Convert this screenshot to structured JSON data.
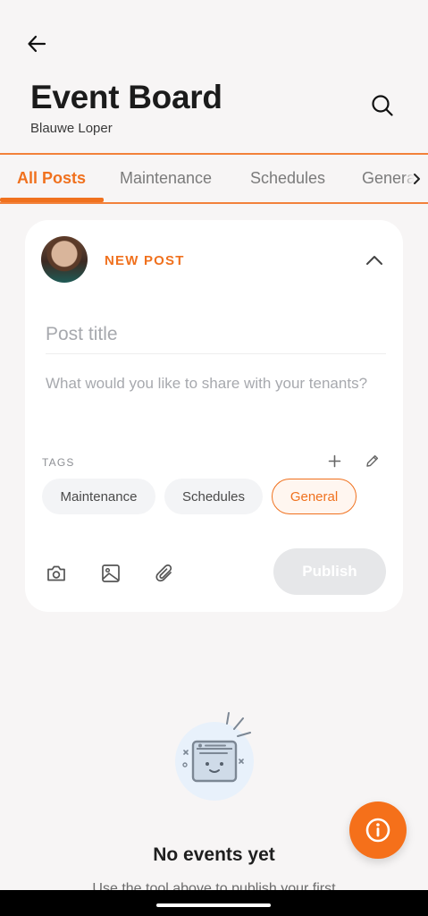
{
  "header": {
    "title": "Event Board",
    "subtitle": "Blauwe Loper",
    "back_icon": "arrow-left-icon",
    "search_icon": "search-icon"
  },
  "tabs": [
    {
      "label": "All Posts",
      "active": true
    },
    {
      "label": "Maintenance",
      "active": false
    },
    {
      "label": "Schedules",
      "active": false
    },
    {
      "label": "General",
      "active": false
    }
  ],
  "composer": {
    "label": "NEW POST",
    "title_placeholder": "Post title",
    "body_placeholder": "What would you like to share with your tenants?",
    "tags_label": "TAGS",
    "tags": [
      {
        "label": "Maintenance",
        "selected": false
      },
      {
        "label": "Schedules",
        "selected": false
      },
      {
        "label": "General",
        "selected": true
      }
    ],
    "tools": [
      "camera-icon",
      "image-icon",
      "paperclip-icon"
    ],
    "publish_label": "Publish"
  },
  "empty_state": {
    "title": "No events yet",
    "subtitle": "Use the tool above to publish your first"
  },
  "colors": {
    "accent": "#f0711e",
    "fab": "#f5701a",
    "background": "#f7f5f5"
  }
}
